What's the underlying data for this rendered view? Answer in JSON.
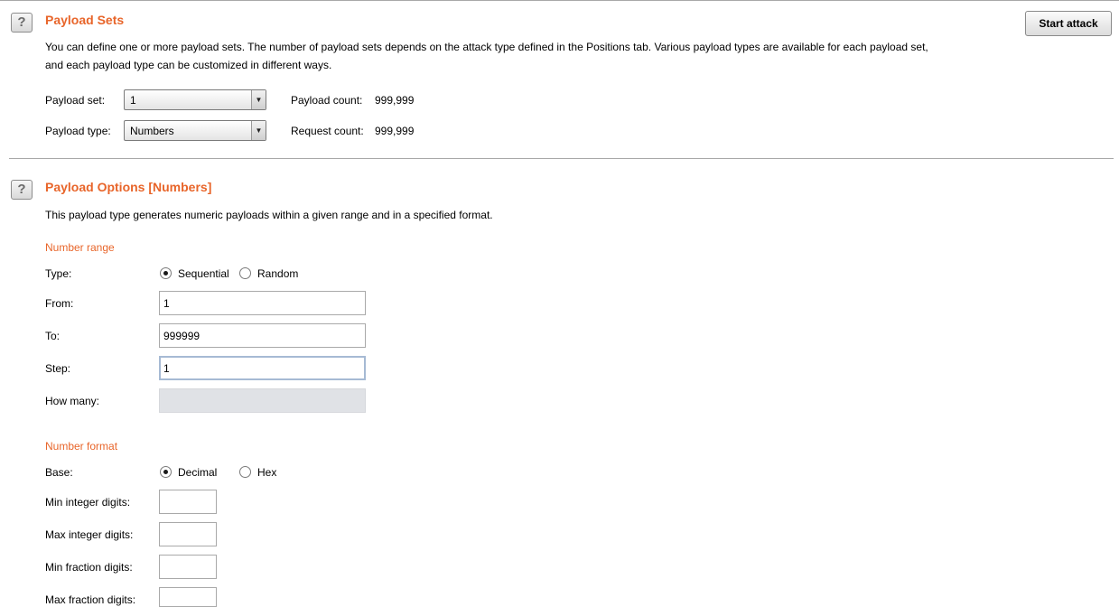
{
  "payload_sets": {
    "title": "Payload Sets",
    "help_symbol": "?",
    "description_line1": "You can define one or more payload sets. The number of payload sets depends on the attack type defined in the Positions tab. Various payload types are available for each payload set,",
    "description_line2": "and each payload type can be customized in different ways.",
    "payload_set_label": "Payload set:",
    "payload_set_value": "1",
    "payload_type_label": "Payload type:",
    "payload_type_value": "Numbers",
    "payload_count_label": "Payload count:",
    "payload_count_value": "999,999",
    "request_count_label": "Request count:",
    "request_count_value": "999,999",
    "start_attack_label": "Start attack"
  },
  "payload_options": {
    "title": "Payload Options [Numbers]",
    "help_symbol": "?",
    "description": "This payload type generates numeric payloads within a given range and in a specified format.",
    "number_range": {
      "heading": "Number range",
      "type_label": "Type:",
      "sequential_label": "Sequential",
      "random_label": "Random",
      "selected": "Sequential",
      "from_label": "From:",
      "from_value": "1",
      "to_label": "To:",
      "to_value": "999999",
      "step_label": "Step:",
      "step_value": "1",
      "how_many_label": "How many:",
      "how_many_value": ""
    },
    "number_format": {
      "heading": "Number format",
      "base_label": "Base:",
      "decimal_label": "Decimal",
      "hex_label": "Hex",
      "selected": "Decimal",
      "min_integer_label": "Min integer digits:",
      "max_integer_label": "Max integer digits:",
      "min_fraction_label": "Min fraction digits:",
      "max_fraction_label": "Max fraction digits:",
      "min_integer_value": "",
      "max_integer_value": "",
      "min_fraction_value": "",
      "max_fraction_value": ""
    }
  },
  "colors": {
    "accent": "#e8652a",
    "divider": "#a8a8a8",
    "focus_border": "#a6bad4",
    "disabled_field": "#e0e2e6"
  }
}
